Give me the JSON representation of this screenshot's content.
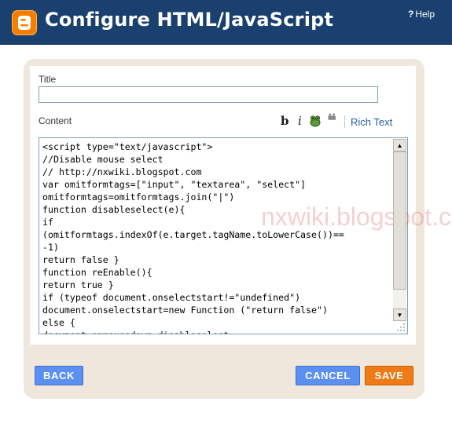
{
  "header": {
    "title": "Configure HTML/JavaScript",
    "help_label": "Help",
    "help_icon": "?",
    "brand_color": "#19406e",
    "logo_color": "#f57d00"
  },
  "form": {
    "title_label": "Title",
    "title_value": "",
    "content_label": "Content"
  },
  "toolbar": {
    "bold_icon": "b",
    "italic_icon": "i",
    "image_icon": "frog-icon",
    "quote_icon": "❝",
    "rich_text_label": "Rich Text"
  },
  "content": {
    "lines": [
      "<script type=\"text/javascript\">",
      "//Disable mouse select",
      "// http://nxwiki.blogspot.com",
      "var omitformtags=[\"input\", \"textarea\", \"select\"]",
      "omitformtags=omitformtags.join(\"|\")",
      "function disableselect(e){",
      "if",
      "(omitformtags.indexOf(e.target.tagName.toLowerCase())==",
      "-1)",
      "return false }",
      "function reEnable(){",
      "return true }",
      "if (typeof document.onselectstart!=\"undefined\")",
      "document.onselectstart=new Function (\"return false\")",
      "else {",
      "document.onmousedown=disableselect"
    ],
    "watermark": "nxwiki.blogspot.com"
  },
  "buttons": {
    "back_label": "BACK",
    "cancel_label": "CANCEL",
    "save_label": "SAVE",
    "blue": "#5b8ff0",
    "orange": "#f07a16"
  }
}
